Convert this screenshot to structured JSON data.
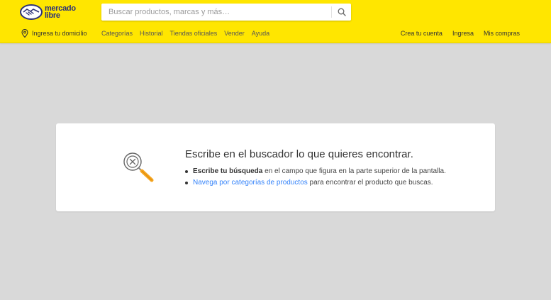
{
  "brand": {
    "line1": "mercado",
    "line2": "libre",
    "logo_color": "#2d3277",
    "header_color": "#ffe600"
  },
  "search": {
    "placeholder": "Buscar productos, marcas y más…",
    "icon": "search-icon"
  },
  "location": {
    "label": "Ingresa tu domicilio",
    "icon": "location-pin-icon"
  },
  "nav": {
    "items": [
      {
        "label": "Categorías"
      },
      {
        "label": "Historial"
      },
      {
        "label": "Tiendas oficiales"
      },
      {
        "label": "Vender"
      },
      {
        "label": "Ayuda"
      }
    ],
    "right": [
      {
        "label": "Crea tu cuenta"
      },
      {
        "label": "Ingresa"
      },
      {
        "label": "Mis compras"
      }
    ]
  },
  "empty_state": {
    "icon": "magnifier-with-x-icon",
    "title": "Escribe en el buscador lo que quieres encontrar.",
    "tip1": {
      "bold": "Escribe tu búsqueda",
      "rest": " en el campo que figura en la parte superior de la pantalla."
    },
    "tip2": {
      "link": "Navega por categorías de productos",
      "rest": " para encontrar el producto que buscas.",
      "link_color": "#3483fa"
    }
  }
}
